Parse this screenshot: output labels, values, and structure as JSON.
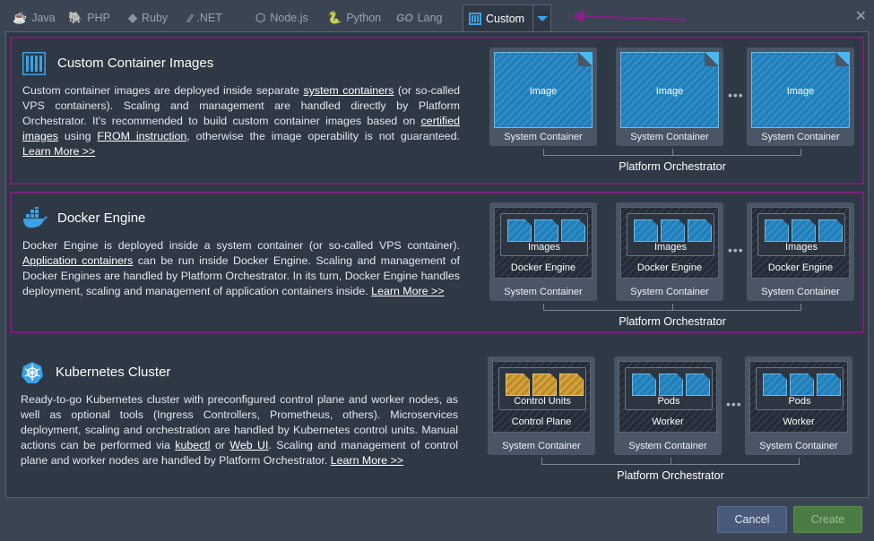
{
  "tabs": [
    {
      "label": "Java",
      "icon": "java-icon"
    },
    {
      "label": "PHP",
      "icon": "php-icon"
    },
    {
      "label": "Ruby",
      "icon": "ruby-icon"
    },
    {
      "label": ".NET",
      "icon": "dotnet-icon"
    },
    {
      "label": "Node.js",
      "icon": "nodejs-icon"
    },
    {
      "label": "Python",
      "icon": "python-icon"
    },
    {
      "label": "Lang",
      "icon": "go-icon"
    },
    {
      "label": "Custom",
      "icon": "custom-icon",
      "active": true
    }
  ],
  "go_logo": "GO",
  "sections": {
    "custom": {
      "title": "Custom Container Images",
      "desc": {
        "t1": "Custom container images are deployed inside separate ",
        "l1": "system containers",
        "t2": " (or so-called VPS containers). Scaling and management are handled directly by Platform Orchestrator. It's recommended to build custom container images based on ",
        "l2": "certified images",
        "t3": " using ",
        "l3": "FROM instruction",
        "t4": ", otherwise the image operability is not guaranteed. ",
        "l4": "Learn More >>"
      },
      "image_label": "Image",
      "container_label": "System Container",
      "orchestrator": "Platform Orchestrator"
    },
    "docker": {
      "title": "Docker Engine",
      "desc": {
        "t1": "Docker Engine is deployed inside a system container (or so-called VPS container). ",
        "l1": "Application containers",
        "t2": " can be run inside Docker Engine. Scaling and management of Docker Engines are handled by Platform Orchestrator. In its turn, Docker Engine handles deployment, scaling and management of application containers inside. ",
        "l2": "Learn More >>"
      },
      "inner_label": "Images",
      "engine_label": "Docker Engine",
      "container_label": "System Container",
      "orchestrator": "Platform Orchestrator"
    },
    "k8s": {
      "title": "Kubernetes Cluster",
      "desc": {
        "t1": "Ready-to-go Kubernetes cluster with preconfigured control plane and worker nodes, as well as optional tools (Ingress Controllers, Prometheus, others). Microservices deployment, scaling and orchestration are handled by Kubernetes control units. Manual actions can be performed via ",
        "l1": "kubectl",
        "t2": " or ",
        "l2": "Web UI",
        "t3": ". Scaling and management of control plane and worker nodes are handled by Platform Orchestrator. ",
        "l3": "Learn More >>"
      },
      "control_units": "Control Units",
      "control_plane": "Control Plane",
      "pods": "Pods",
      "worker": "Worker",
      "container_label": "System Container",
      "orchestrator": "Platform Orchestrator"
    }
  },
  "ellipsis": "•••",
  "buttons": {
    "cancel": "Cancel",
    "create": "Create"
  },
  "colors": {
    "accent": "#3aa2e6",
    "highlight": "#7b1f7a",
    "create": "#4b7c43",
    "cancel": "#4a5a7a"
  }
}
